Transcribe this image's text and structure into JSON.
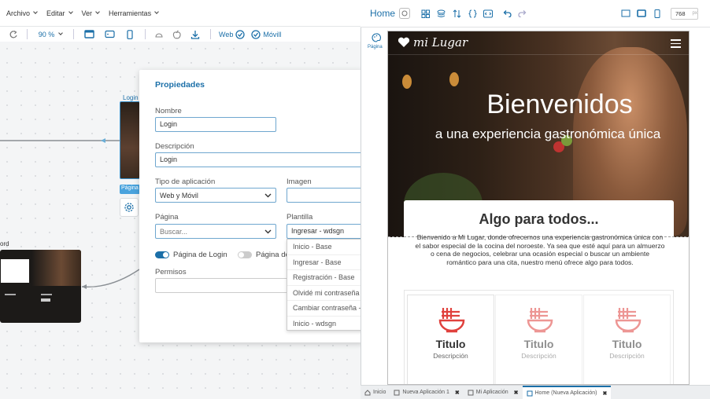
{
  "menubar": {
    "items": [
      "Archivo",
      "Editar",
      "Ver",
      "Herramientas"
    ]
  },
  "toolbar": {
    "zoom": "90 %",
    "web_label": "Web",
    "movil_label": "Móvill"
  },
  "canvas": {
    "login_label": "Login",
    "pagina_badge": "Página",
    "ord_label": "ord"
  },
  "properties": {
    "title": "Propiedades",
    "nombre_label": "Nombre",
    "nombre_value": "Login",
    "descripcion_label": "Descripción",
    "descripcion_value": "Login",
    "tipo_label": "Tipo de aplicación",
    "tipo_value": "Web y Móvil",
    "imagen_label": "Imagen",
    "pagina_label": "Página",
    "pagina_placeholder": "Buscar...",
    "plantilla_label": "Plantilla",
    "plantilla_value": "Ingresar - wdsgn",
    "toggle1_label": "Página de Login",
    "toggle2_label": "Página de",
    "permisos_label": "Permisos",
    "dropdown_options": [
      "Inicio - Base",
      "Ingresar - Base",
      "Registración - Base",
      "Olvidé mi contraseña - Base",
      "Cambiar contraseña - Base",
      "Inicio - wdsgn"
    ]
  },
  "right_header": {
    "title": "Home",
    "width_value": "768",
    "width_unit": "px",
    "side_label": "Página"
  },
  "preview": {
    "brand": "mi Lugar",
    "hero_title": "Bienvenidos",
    "hero_subtitle": "a una experiencia gastronómica única",
    "section_title": "Algo para todos...",
    "paragraph": "Bienvenido a Mi Lugar, donde ofrecemos una experiencia gastronómica única con el sabor especial de la cocina del noroeste. Ya sea que esté aquí para un almuerzo o cena de negocios, celebrar una ocasión especial o buscar un ambiente romántico para una cita, nuestro menú ofrece algo para todos.",
    "cards": [
      {
        "title": "Titulo",
        "desc": "Descripción"
      },
      {
        "title": "Titulo",
        "desc": "Descripción"
      },
      {
        "title": "Titulo",
        "desc": "Descripción"
      }
    ]
  },
  "bottom_tabs": [
    "Inicio",
    "Nueva Aplicación 1",
    "Mi Aplicación",
    "Home (Nueva Aplicación)"
  ],
  "colors": {
    "accent": "#1b6fa8",
    "brand_red": "#e0413d"
  }
}
